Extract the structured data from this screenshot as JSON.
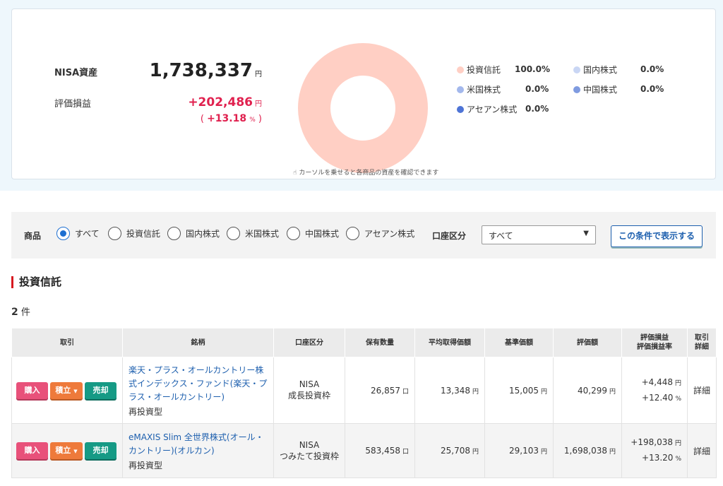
{
  "summary": {
    "asset_label": "NISA資産",
    "asset_value": "1,738,337",
    "asset_unit": "円",
    "pl_label": "評価損益",
    "pl_value": "+202,486",
    "pl_unit": "円",
    "pl_pct_open": "(",
    "pl_pct_value": "+13.18",
    "pl_pct_unit": "%",
    "pl_pct_close": ")"
  },
  "allocation": {
    "hint": "カーソルを乗せると各商品の資産を確認できます",
    "items": [
      {
        "label": "投資信託",
        "value": "100.0%",
        "color": "#ffcfc4"
      },
      {
        "label": "国内株式",
        "value": "0.0%",
        "color": "#c9d6f4"
      },
      {
        "label": "米国株式",
        "value": "0.0%",
        "color": "#a3b8ec"
      },
      {
        "label": "中国株式",
        "value": "0.0%",
        "color": "#7f9be0"
      },
      {
        "label": "アセアン株式",
        "value": "0.0%",
        "color": "#4e74d6"
      }
    ]
  },
  "filter": {
    "product_label": "商品",
    "options": [
      "すべて",
      "投資信託",
      "国内株式",
      "米国株式",
      "中国株式",
      "アセアン株式"
    ],
    "selected": "すべて",
    "account_label": "口座区分",
    "account_value": "すべて",
    "submit_label": "この条件で表示する"
  },
  "section": {
    "title": "投資信託",
    "count": "2",
    "count_unit": "件"
  },
  "table": {
    "headers": {
      "trade": "取引",
      "name": "銘柄",
      "account": "口座区分",
      "qty": "保有数量",
      "avg": "平均取得価額",
      "base": "基準価額",
      "value": "評価額",
      "pl1": "評価損益",
      "pl2": "評価損益率",
      "detail1": "取引",
      "detail2": "詳細"
    },
    "buttons": {
      "buy": "購入",
      "accumulate": "積立",
      "sell": "売却"
    },
    "rows": [
      {
        "name": "楽天・プラス・オールカントリー株式インデックス・ファンド(楽天・プラス・オールカントリー)",
        "type": "再投資型",
        "account1": "NISA",
        "account2": "成長投資枠",
        "qty": "26,857",
        "qty_unit": "口",
        "avg": "13,348",
        "base": "15,005",
        "value": "40,299",
        "pl": "+4,448",
        "pl_rate": "+12.40",
        "yen": "円",
        "pct": "%",
        "detail": "詳細"
      },
      {
        "name": "eMAXIS Slim 全世界株式(オール・カントリー)(オルカン)",
        "type": "再投資型",
        "account1": "NISA",
        "account2": "つみたて投資枠",
        "qty": "583,458",
        "qty_unit": "口",
        "avg": "25,708",
        "base": "29,103",
        "value": "1,698,038",
        "pl": "+198,038",
        "pl_rate": "+13.20",
        "yen": "円",
        "pct": "%",
        "detail": "詳細"
      }
    ]
  }
}
